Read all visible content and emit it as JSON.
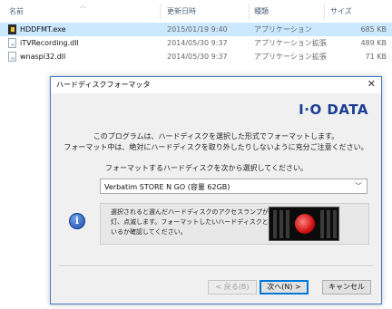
{
  "explorer": {
    "columns": {
      "name": "名前",
      "date": "更新日時",
      "type": "種類",
      "size": "サイズ"
    },
    "files": [
      {
        "name": "HDDFMT.exe",
        "date": "2015/01/19 9:40",
        "type": "アプリケーション",
        "size": "685 KB",
        "icon": "exe-icon"
      },
      {
        "name": "iTVRecording.dll",
        "date": "2014/05/30 9:37",
        "type": "アプリケーション拡張",
        "size": "489 KB",
        "icon": "dll-icon"
      },
      {
        "name": "wnaspi32.dll",
        "date": "2014/05/30 9:37",
        "type": "アプリケーション拡張",
        "size": "71 KB",
        "icon": "dll-icon"
      }
    ]
  },
  "dialog": {
    "title": "ハードディスクフォーマッタ",
    "brand": "I·O DATA",
    "intro_line1": "このプログラムは、ハードディスクを選択した形式でフォーマットします。",
    "intro_line2": "フォーマット中は、絶対にハードディスクを取り外したりしないように充分ご注意ください。",
    "select_label": "フォーマットするハードディスクを次から選択してください。",
    "selected_disk": "Verbatim STORE N GO (容量 62GB)",
    "info_line1": "選択されると選んだハードディスクのアクセスランプが点",
    "info_line2": "灯、点滅します。フォーマットしたいハードディスクと合って",
    "info_line3": "いるか確認してください。",
    "buttons": {
      "back": "< 戻る(B)",
      "next": "次へ(N) >",
      "cancel": "キャンセル"
    },
    "accent_color": "#1c3f94"
  }
}
